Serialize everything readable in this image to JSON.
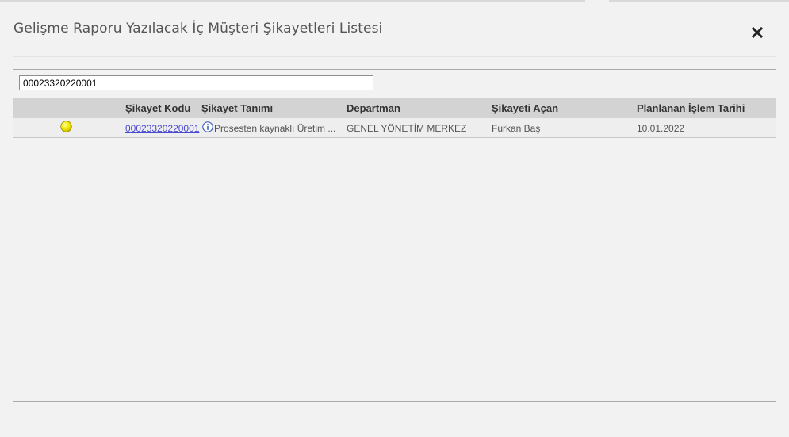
{
  "modal": {
    "title": "Gelişme Raporu Yazılacak İç Müşteri Şikayetleri Listesi",
    "close_icon": "close-icon"
  },
  "search": {
    "value": "00023320220001"
  },
  "table": {
    "columns": [
      "Şikayet Kodu",
      "Şikayet Tanımı",
      "Departman",
      "Şikayeti Açan",
      "Planlanan İşlem Tarihi"
    ],
    "rows": [
      {
        "status_icon": "yellow-circle-icon",
        "status_color": "#f2e600",
        "code": "00023320220001",
        "description": "Prosesten kaynaklı Üretim ...",
        "department": "GENEL YÖNETİM MERKEZ",
        "opened_by": "Furkan Baş",
        "planned_date": "10.01.2022"
      }
    ]
  },
  "colors": {
    "background": "#f2f2f2",
    "header_bg": "#d3d3d3",
    "link": "#4a4ad1",
    "info_icon": "#3b5fc4"
  }
}
